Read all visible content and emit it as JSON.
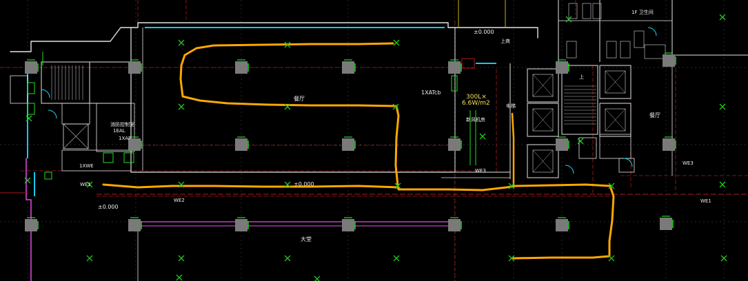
{
  "canvas": {
    "background": "#000000"
  },
  "colors": {
    "wall_red": "#c81e1e",
    "axis_red": "#b01818",
    "wall_white": "#e6e6e6",
    "glass_cyan": "#17c8f0",
    "facade_magenta": "#c040c0",
    "column_gray": "#7a7a7a",
    "bracket_green": "#22e022",
    "node_green": "#1ec81e",
    "route_orange": "#ffa800",
    "text_white": "#f0f0f0",
    "text_yellow": "#f5e05a",
    "door_cyan": "#12d8f0"
  },
  "labels": {
    "level_top": "±0.000",
    "level_mid": "±0.000",
    "level_left": "±0.000",
    "hall_1": "餐厅",
    "hall_2": "餐厅",
    "hall_3": "大堂",
    "shop": "上商",
    "wc": "1F 卫生间",
    "panel": "1XATcb",
    "capacity_line1": "300L×",
    "capacity_line2": "6.6W/m2",
    "mech_room": "新风机房",
    "control_room": "消防控制室",
    "control_room_sub": "1EAL",
    "ap_left": "1XAP",
    "fire_pump": "1XWE",
    "duct_1": "WE1",
    "duct_2": "WE2",
    "duct_3": "WE3",
    "duct_4": "WE3",
    "duct_5": "WE1",
    "stair_up": "上",
    "elev_left": "电梯"
  }
}
